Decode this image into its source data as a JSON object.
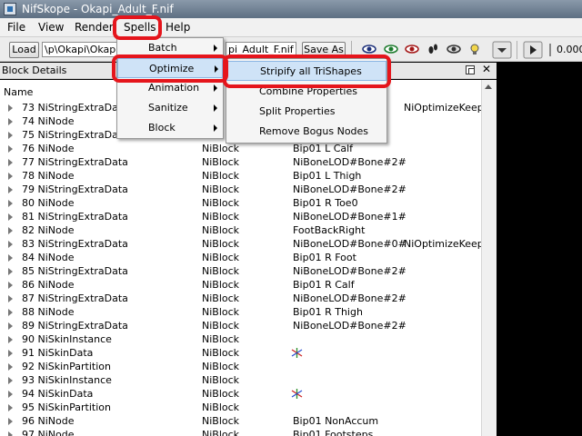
{
  "window": {
    "title": "NifSkope - Okapi_Adult_F.nif"
  },
  "menubar": {
    "file": "File",
    "view": "View",
    "render": "Render",
    "spells": "Spells",
    "help": "Help"
  },
  "toolbar": {
    "load_label": "Load",
    "path_value": "\\p\\Okapi\\Okapi",
    "file_value": "pi_Adult_F.nif",
    "save_as_label": "Save As",
    "zoom_value": "0.000"
  },
  "dock": {
    "title": "Block Details",
    "column_name": "Name"
  },
  "spells_menu": {
    "items": [
      "Batch",
      "Optimize",
      "Animation",
      "Sanitize",
      "Block"
    ]
  },
  "optimize_menu": {
    "items": [
      "Stripify all TriShapes",
      "Combine Properties",
      "Split Properties",
      "Remove Bogus Nodes"
    ]
  },
  "tree_rows": [
    {
      "name": "73 NiStringExtraData",
      "type": "",
      "value": "",
      "extra": "NiOptimizeKeep",
      "icon": ""
    },
    {
      "name": "74 NiNode",
      "type": "",
      "value": "",
      "extra": "",
      "icon": ""
    },
    {
      "name": "75 NiStringExtraData",
      "type": "",
      "value": "",
      "extra": "",
      "icon": ""
    },
    {
      "name": "76 NiNode",
      "type": "NiBlock",
      "value": "Bip01 L Calf",
      "extra": "",
      "icon": ""
    },
    {
      "name": "77 NiStringExtraData",
      "type": "NiBlock",
      "value": "NiBoneLOD#Bone#2#",
      "extra": "",
      "icon": ""
    },
    {
      "name": "78 NiNode",
      "type": "NiBlock",
      "value": "Bip01 L Thigh",
      "extra": "",
      "icon": ""
    },
    {
      "name": "79 NiStringExtraData",
      "type": "NiBlock",
      "value": "NiBoneLOD#Bone#2#",
      "extra": "",
      "icon": ""
    },
    {
      "name": "80 NiNode",
      "type": "NiBlock",
      "value": "Bip01 R Toe0",
      "extra": "",
      "icon": ""
    },
    {
      "name": "81 NiStringExtraData",
      "type": "NiBlock",
      "value": "NiBoneLOD#Bone#1#",
      "extra": "",
      "icon": ""
    },
    {
      "name": "82 NiNode",
      "type": "NiBlock",
      "value": "FootBackRight",
      "extra": "",
      "icon": ""
    },
    {
      "name": "83 NiStringExtraData",
      "type": "NiBlock",
      "value": "NiBoneLOD#Bone#0#",
      "extra": "NiOptimizeKeep",
      "icon": ""
    },
    {
      "name": "84 NiNode",
      "type": "NiBlock",
      "value": "Bip01 R Foot",
      "extra": "",
      "icon": ""
    },
    {
      "name": "85 NiStringExtraData",
      "type": "NiBlock",
      "value": "NiBoneLOD#Bone#2#",
      "extra": "",
      "icon": ""
    },
    {
      "name": "86 NiNode",
      "type": "NiBlock",
      "value": "Bip01 R Calf",
      "extra": "",
      "icon": ""
    },
    {
      "name": "87 NiStringExtraData",
      "type": "NiBlock",
      "value": "NiBoneLOD#Bone#2#",
      "extra": "",
      "icon": ""
    },
    {
      "name": "88 NiNode",
      "type": "NiBlock",
      "value": "Bip01 R Thigh",
      "extra": "",
      "icon": ""
    },
    {
      "name": "89 NiStringExtraData",
      "type": "NiBlock",
      "value": "NiBoneLOD#Bone#2#",
      "extra": "",
      "icon": ""
    },
    {
      "name": "90 NiSkinInstance",
      "type": "NiBlock",
      "value": "",
      "extra": "",
      "icon": ""
    },
    {
      "name": "91 NiSkinData",
      "type": "NiBlock",
      "value": "",
      "extra": "",
      "icon": "axes-icon"
    },
    {
      "name": "92 NiSkinPartition",
      "type": "NiBlock",
      "value": "",
      "extra": "",
      "icon": ""
    },
    {
      "name": "93 NiSkinInstance",
      "type": "NiBlock",
      "value": "",
      "extra": "",
      "icon": ""
    },
    {
      "name": "94 NiSkinData",
      "type": "NiBlock",
      "value": "",
      "extra": "",
      "icon": "axes-icon"
    },
    {
      "name": "95 NiSkinPartition",
      "type": "NiBlock",
      "value": "",
      "extra": "",
      "icon": ""
    },
    {
      "name": "96 NiNode",
      "type": "NiBlock",
      "value": "Bip01 NonAccum",
      "extra": "",
      "icon": ""
    },
    {
      "name": "97 NiNode",
      "type": "NiBlock",
      "value": "Bip01 Footsteps",
      "extra": "",
      "icon": ""
    }
  ],
  "colors": {
    "highlight_box": "#e5151c",
    "menu_hover": "#cfe3f7"
  }
}
